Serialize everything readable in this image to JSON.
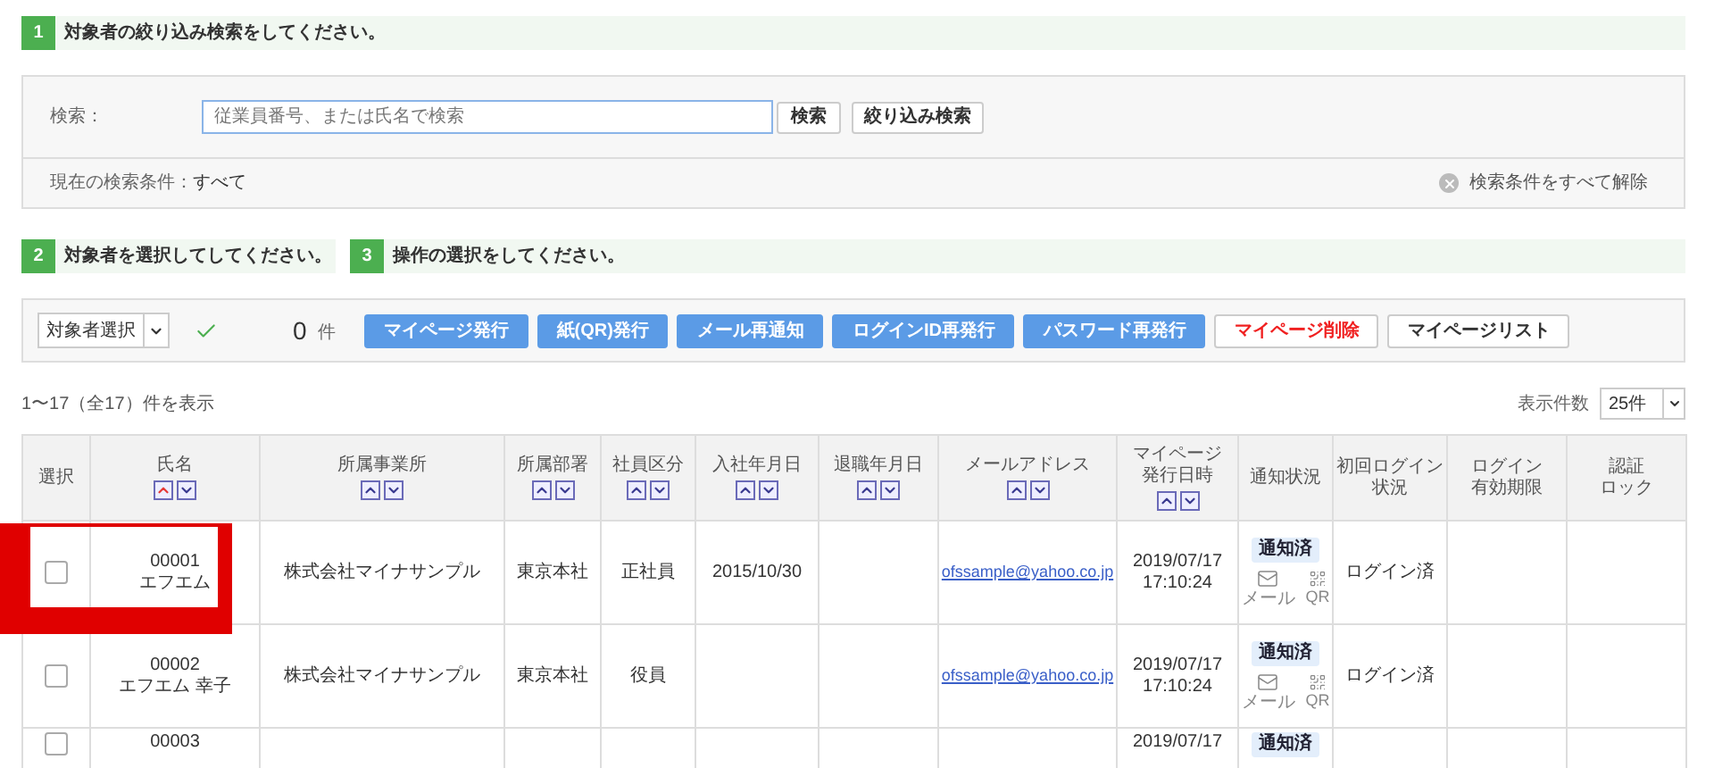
{
  "step1": {
    "number": "1",
    "title": "対象者の絞り込み検索をしてください。"
  },
  "search": {
    "label": "検索：",
    "placeholder": "従業員番号、または氏名で検索",
    "search_button": "検索",
    "filter_button": "絞り込み検索",
    "condition_label": "現在の検索条件：",
    "condition_value": "すべて",
    "clear": "検索条件をすべて解除"
  },
  "step2": {
    "number": "2",
    "title": "対象者を選択してしてください。"
  },
  "step3": {
    "number": "3",
    "title": "操作の選択をしてください。"
  },
  "actions": {
    "target_select": "対象者選択",
    "count": "0",
    "count_unit": "件",
    "buttons": [
      {
        "label": "マイページ発行",
        "kind": "primary"
      },
      {
        "label": "紙(QR)発行",
        "kind": "primary"
      },
      {
        "label": "メール再通知",
        "kind": "primary"
      },
      {
        "label": "ログインID再発行",
        "kind": "primary"
      },
      {
        "label": "パスワード再発行",
        "kind": "primary"
      },
      {
        "label": "マイページ削除",
        "kind": "danger"
      },
      {
        "label": "マイページリスト",
        "kind": "default"
      }
    ]
  },
  "summary": "1〜17（全17）件を表示",
  "page_size": {
    "label": "表示件数",
    "value": "25件"
  },
  "table": {
    "columns": [
      {
        "lines": [
          "選択"
        ],
        "sortable": false
      },
      {
        "lines": [
          "氏名"
        ],
        "sortable": true,
        "sort_up_active": true
      },
      {
        "lines": [
          "所属事業所"
        ],
        "sortable": true,
        "sort_up_active": false
      },
      {
        "lines": [
          "所属部署"
        ],
        "sortable": true,
        "sort_up_active": false
      },
      {
        "lines": [
          "社員区分"
        ],
        "sortable": true,
        "sort_up_active": false
      },
      {
        "lines": [
          "入社年月日"
        ],
        "sortable": true,
        "sort_up_active": false
      },
      {
        "lines": [
          "退職年月日"
        ],
        "sortable": true,
        "sort_up_active": false
      },
      {
        "lines": [
          "メールアドレス"
        ],
        "sortable": true,
        "sort_up_active": false
      },
      {
        "lines": [
          "マイページ",
          "発行日時"
        ],
        "sortable": true,
        "sort_up_active": false
      },
      {
        "lines": [
          "通知状況"
        ],
        "sortable": false
      },
      {
        "lines": [
          "初回ログイン",
          "状況"
        ],
        "sortable": false
      },
      {
        "lines": [
          "ログイン",
          "有効期限"
        ],
        "sortable": false
      },
      {
        "lines": [
          "認証",
          "ロック"
        ],
        "sortable": false
      }
    ],
    "rows": [
      {
        "highlighted": true,
        "checked": false,
        "id": "00001",
        "name": "エフエム",
        "office": "株式会社マイナサンプル",
        "dept": "東京本社",
        "type": "正社員",
        "hired": "2015/10/30",
        "email": "ofssample@yahoo.co.jp",
        "issued": [
          "2019/07/17",
          "17:10:24"
        ],
        "notice": "通知済",
        "mail_label": "メール",
        "qr_label": "QR",
        "login": "ログイン済"
      },
      {
        "highlighted": false,
        "checked": false,
        "id": "00002",
        "name": "エフエム 幸子",
        "office": "株式会社マイナサンプル",
        "dept": "東京本社",
        "type": "役員",
        "email": "ofssample@yahoo.co.jp",
        "issued": [
          "2019/07/17",
          "17:10:24"
        ],
        "notice": "通知済",
        "mail_label": "メール",
        "qr_label": "QR",
        "login": "ログイン済"
      },
      {
        "highlighted": false,
        "checked": false,
        "id": "00003",
        "issued": [
          "2019/07/17"
        ],
        "notice": "通知済"
      }
    ]
  }
}
